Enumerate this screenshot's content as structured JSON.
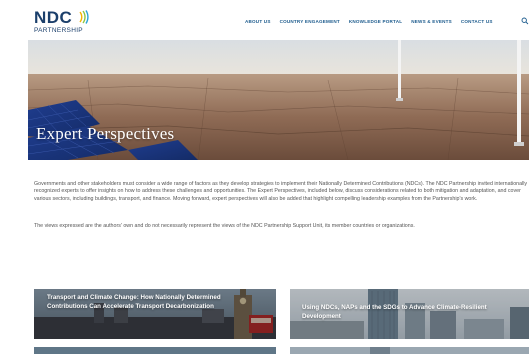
{
  "logo": {
    "main": "NDC",
    "sub": "PARTNERSHIP"
  },
  "nav": [
    "ABOUT US",
    "COUNTRY ENGAGEMENT",
    "KNOWLEDGE PORTAL",
    "NEWS & EVENTS",
    "CONTACT US"
  ],
  "hero": {
    "title": "Expert Perspectives"
  },
  "intro": "Governments and other stakeholders must consider a wide range of factors as they develop strategies to implement their Nationally Determined Contributions (NDCs). The NDC Partnership invited internationally recognized experts to offer insights on how to address these challenges and opportunities. The Expert Perspectives, included below, discuss considerations related to both mitigation and adaptation, and cover various sectors, including buildings, transport, and finance. Moving forward, expert perspectives will also be added that highlight compelling leadership examples from the Partnership's work.",
  "disclaimer": "The views expressed are the authors' own and do not necessarily represent the views of the NDC Partnership Support Unit, its member countries or organizations.",
  "cards": [
    {
      "title": "Transport and Climate Change: How Nationally Determined Contributions Can Accelerate Transport Decarbonization"
    },
    {
      "title": "Using NDCs, NAPs and the SDGs to Advance Climate-Resilient Development"
    }
  ],
  "colors": {
    "brand_blue": "#1b3f6b",
    "nav_blue": "#1b5a8c",
    "accent_green": "#8dc63f"
  },
  "icons": [
    "search-icon"
  ]
}
